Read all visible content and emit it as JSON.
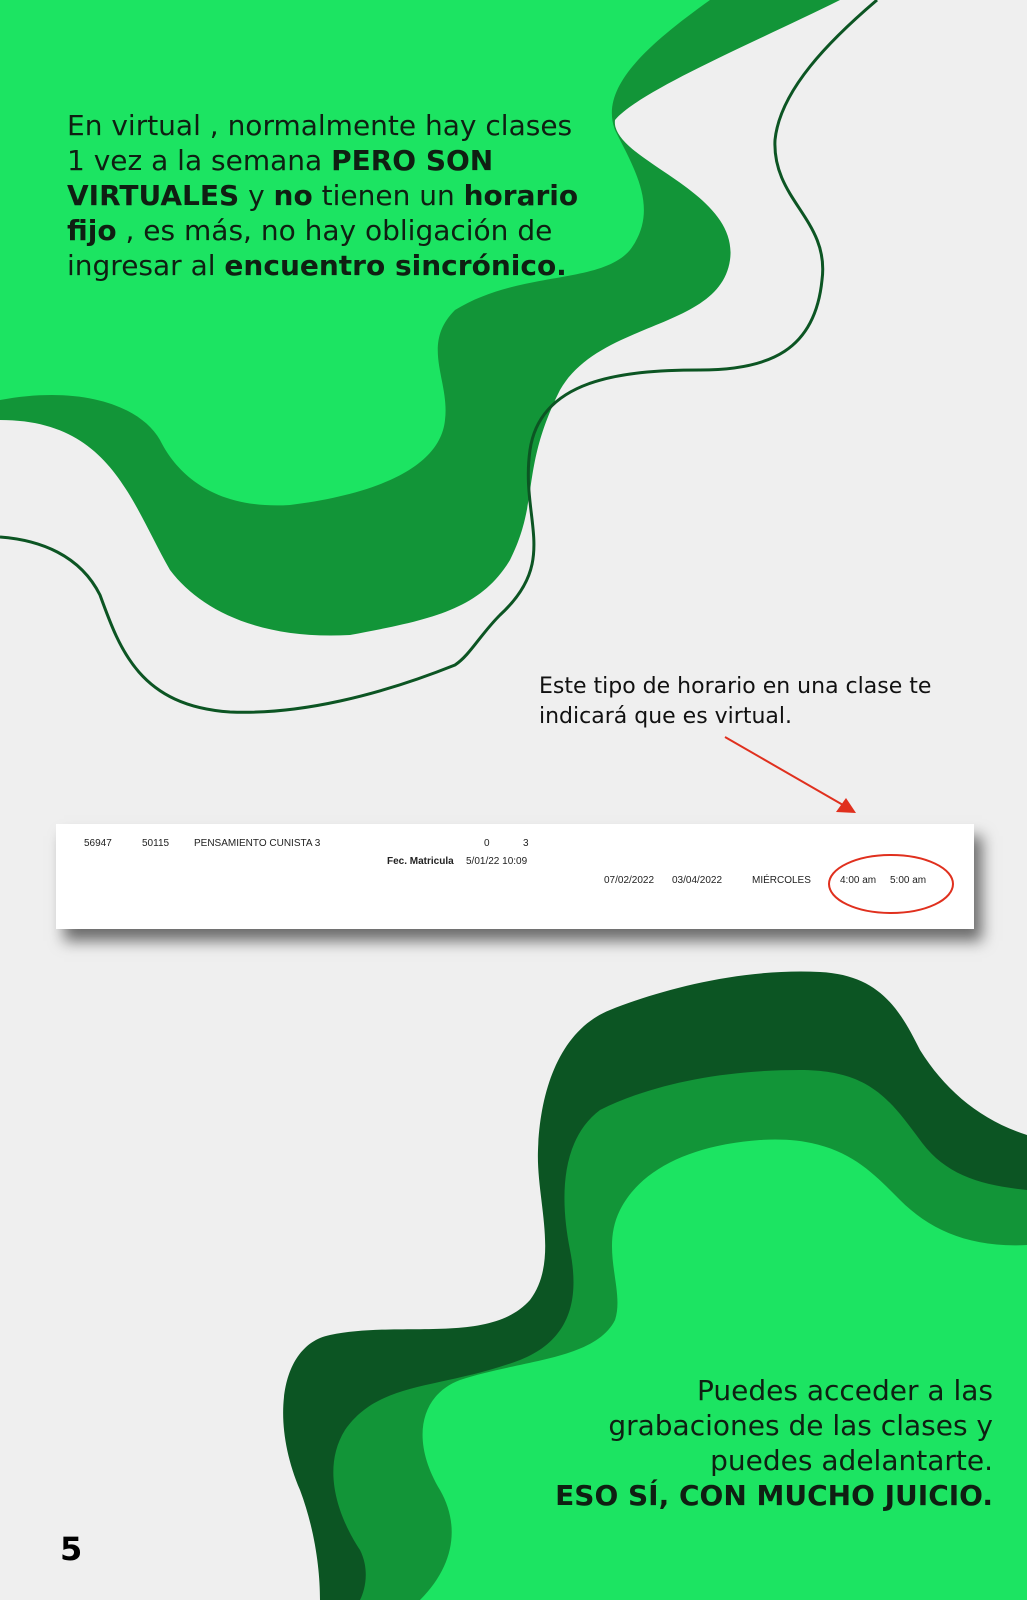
{
  "intro": {
    "t1": "En virtual , normalmente hay clases 1 vez a la semana ",
    "t2": "PERO SON VIRTUALES",
    "t3": " y ",
    "t4": "no",
    "t5": " tienen un ",
    "t6": "horario fijo",
    "t7": " , es más, no hay obligación de ingresar al ",
    "t8": "encuentro sincrónico."
  },
  "note": "Este tipo de horario en una clase te indicará que es virtual.",
  "schedule_row": {
    "code1": "56947",
    "code2": "50115",
    "course": "PENSAMIENTO CUNISTA 3",
    "num1": "0",
    "num2": "3",
    "enroll_label": "Fec. Matricula",
    "enroll_value": "5/01/22 10:09",
    "start_date": "07/02/2022",
    "end_date": "03/04/2022",
    "day": "MIÉRCOLES",
    "start_time": "4:00 am",
    "end_time": "5:00 am"
  },
  "outro": {
    "line1": "Puedes acceder a las grabaciones de las clases y puedes adelantarte.",
    "line2": "ESO SÍ, CON MUCHO JUICIO."
  },
  "page_number": "5",
  "colors": {
    "bright_green": "#1ce462",
    "mid_green": "#129538",
    "dark_green": "#0c5523",
    "annotation_red": "#e0301e"
  }
}
